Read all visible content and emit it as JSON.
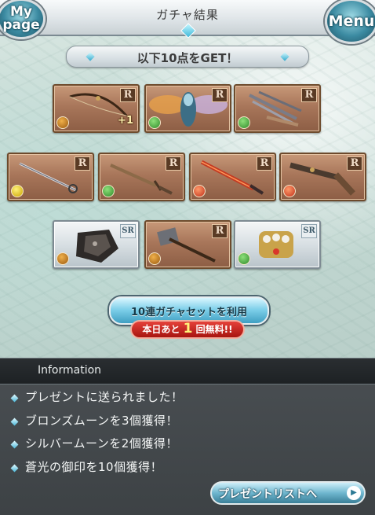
{
  "header": {
    "title": "ガチャ結果",
    "mypage_label_1": "My",
    "mypage_label_2": "page",
    "menu_label": "Menu"
  },
  "banner": {
    "text": "以下10点をGET！"
  },
  "cards": [
    {
      "rarity": "R",
      "element": "earth-icon",
      "plus": "+1",
      "art": "bow-icon"
    },
    {
      "rarity": "R",
      "element": "wind-icon",
      "plus": "",
      "art": "winged-summon-icon"
    },
    {
      "rarity": "R",
      "element": "wind-icon",
      "plus": "",
      "art": "claw-gauntlet-icon"
    },
    {
      "rarity": "R",
      "element": "light-icon",
      "plus": "",
      "art": "rapier-icon"
    },
    {
      "rarity": "R",
      "element": "wind-icon",
      "plus": "",
      "art": "dagger-icon"
    },
    {
      "rarity": "R",
      "element": "fire-icon",
      "plus": "",
      "art": "flame-sword-icon"
    },
    {
      "rarity": "R",
      "element": "fire-icon",
      "plus": "",
      "art": "gun-icon"
    },
    {
      "rarity": "SR",
      "element": "earth-icon",
      "plus": "",
      "art": "fist-gauntlet-icon"
    },
    {
      "rarity": "R",
      "element": "earth-icon",
      "plus": "",
      "art": "hammer-icon"
    },
    {
      "rarity": "SR",
      "element": "wind-icon",
      "plus": "",
      "art": "knuckle-icon"
    }
  ],
  "gacha_button": {
    "label": "10連ガチャセットを利用"
  },
  "free_badge": {
    "prefix": "本日あと",
    "number": "1",
    "suffix": "回無料!!"
  },
  "info": {
    "title": "Information",
    "lines": [
      "プレゼントに送られました！",
      "ブロンズムーンを3個獲得！",
      "シルバームーンを2個獲得！",
      "蒼光の御印を10個獲得！"
    ],
    "present_button": "プレゼントリストへ"
  },
  "colors": {
    "accent": "#3f9fc2",
    "card_bronze": "#a8765a",
    "card_silver": "#d8dfe3",
    "free_red": "#c7201a",
    "info_bg": "#3d4245"
  }
}
